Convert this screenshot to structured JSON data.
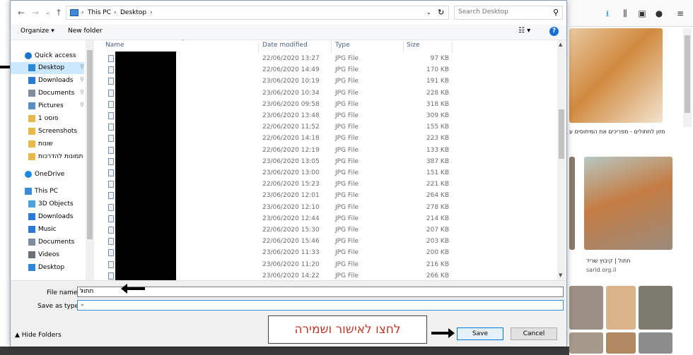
{
  "browser": {
    "caption_top": "מזון לחתולים - מפריכים את המיתוסים ע",
    "caption_cat": "חתול | קיבוץ שריד",
    "caption_src": "sarid.org.il"
  },
  "address": {
    "crumbs": [
      "This PC",
      "Desktop"
    ],
    "search_placeholder": "Search Desktop"
  },
  "toolbar": {
    "organize": "Organize",
    "new_folder": "New folder"
  },
  "nav": [
    {
      "label": "Quick access",
      "icon": "star-icon"
    },
    {
      "label": "Desktop",
      "icon": "desktop-icon",
      "selected": true,
      "pinned": true
    },
    {
      "label": "Downloads",
      "icon": "download-icon",
      "pinned": true
    },
    {
      "label": "Documents",
      "icon": "documents-icon",
      "pinned": true
    },
    {
      "label": "Pictures",
      "icon": "pictures-icon",
      "pinned": true
    },
    {
      "label": "פוסט 1",
      "icon": "folder-icon"
    },
    {
      "label": "Screenshots",
      "icon": "folder-icon"
    },
    {
      "label": "שונות",
      "icon": "folder-icon"
    },
    {
      "label": "תמונות להדרכות",
      "icon": "folder-icon"
    },
    {
      "label": "OneDrive",
      "icon": "cloud-icon"
    },
    {
      "label": "This PC",
      "icon": "computer-icon"
    },
    {
      "label": "3D Objects",
      "icon": "cube-icon"
    },
    {
      "label": "Downloads",
      "icon": "download-icon"
    },
    {
      "label": "Music",
      "icon": "music-icon"
    },
    {
      "label": "Documents",
      "icon": "documents-icon"
    },
    {
      "label": "Videos",
      "icon": "video-icon"
    },
    {
      "label": "Desktop",
      "icon": "desktop-icon"
    }
  ],
  "columns": {
    "name": "Name",
    "date": "Date modified",
    "type": "Type",
    "size": "Size"
  },
  "files": [
    {
      "date": "22/06/2020 13:27",
      "type": "JPG File",
      "size": "97 KB"
    },
    {
      "date": "22/06/2020 14:49",
      "type": "JPG File",
      "size": "170 KB"
    },
    {
      "date": "23/06/2020 10:19",
      "type": "JPG File",
      "size": "191 KB"
    },
    {
      "date": "23/06/2020 10:34",
      "type": "JPG File",
      "size": "228 KB"
    },
    {
      "date": "23/06/2020 09:58",
      "type": "JPG File",
      "size": "318 KB"
    },
    {
      "date": "23/06/2020 13:48",
      "type": "JPG File",
      "size": "309 KB"
    },
    {
      "date": "22/06/2020 11:52",
      "type": "JPG File",
      "size": "155 KB"
    },
    {
      "date": "22/06/2020 14:18",
      "type": "JPG File",
      "size": "223 KB"
    },
    {
      "date": "22/06/2020 12:19",
      "type": "JPG File",
      "size": "133 KB"
    },
    {
      "date": "23/06/2020 13:05",
      "type": "JPG File",
      "size": "387 KB"
    },
    {
      "date": "23/06/2020 13:00",
      "type": "JPG File",
      "size": "151 KB"
    },
    {
      "date": "22/06/2020 15:23",
      "type": "JPG File",
      "size": "221 KB"
    },
    {
      "date": "23/06/2020 12:01",
      "type": "JPG File",
      "size": "264 KB"
    },
    {
      "date": "23/06/2020 12:10",
      "type": "JPG File",
      "size": "278 KB"
    },
    {
      "date": "23/06/2020 12:44",
      "type": "JPG File",
      "size": "214 KB"
    },
    {
      "date": "22/06/2020 15:30",
      "type": "JPG File",
      "size": "207 KB"
    },
    {
      "date": "22/06/2020 15:46",
      "type": "JPG File",
      "size": "203 KB"
    },
    {
      "date": "23/06/2020 11:33",
      "type": "JPG File",
      "size": "200 KB"
    },
    {
      "date": "23/06/2020 11:20",
      "type": "JPG File",
      "size": "216 KB"
    },
    {
      "date": "23/06/2020 14:22",
      "type": "JPG File",
      "size": "266 KB"
    }
  ],
  "bottom": {
    "file_name_label": "File name:",
    "file_name_value": "חתול",
    "save_type_label": "Save as type:",
    "hide_folders": "Hide Folders",
    "save": "Save",
    "cancel": "Cancel"
  },
  "annotation": "לחצו לאישור ושמירה"
}
